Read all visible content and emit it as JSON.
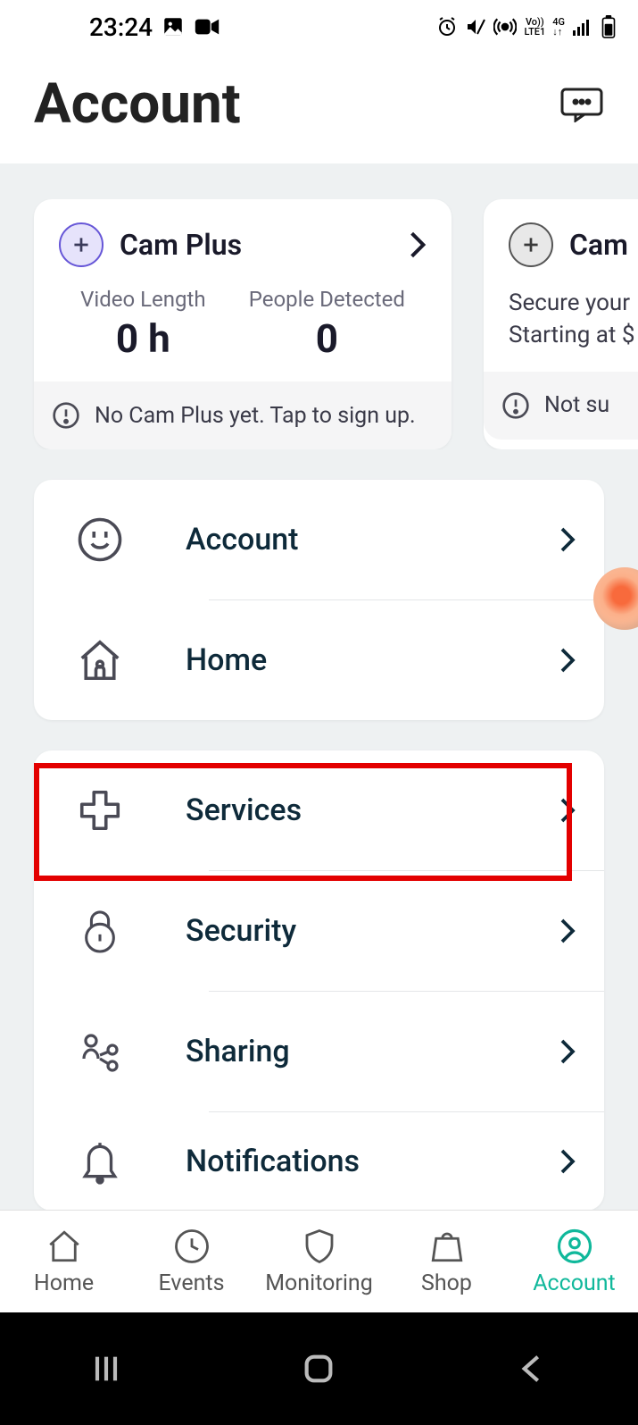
{
  "statusbar": {
    "time": "23:24"
  },
  "header": {
    "title": "Account"
  },
  "promo1": {
    "title": "Cam Plus",
    "stat1_label": "Video Length",
    "stat1_value": "0 h",
    "stat2_label": "People Detected",
    "stat2_value": "0",
    "footer": "No Cam Plus yet. Tap to sign up."
  },
  "promo2": {
    "title": "Cam",
    "line1": "Secure your",
    "line2": "Starting at $",
    "footer": "Not su"
  },
  "menu1": {
    "account": "Account",
    "home": "Home"
  },
  "menu2": {
    "services": "Services",
    "security": "Security",
    "sharing": "Sharing",
    "notifications": "Notifications"
  },
  "nav": {
    "home": "Home",
    "events": "Events",
    "monitoring": "Monitoring",
    "shop": "Shop",
    "account": "Account"
  }
}
